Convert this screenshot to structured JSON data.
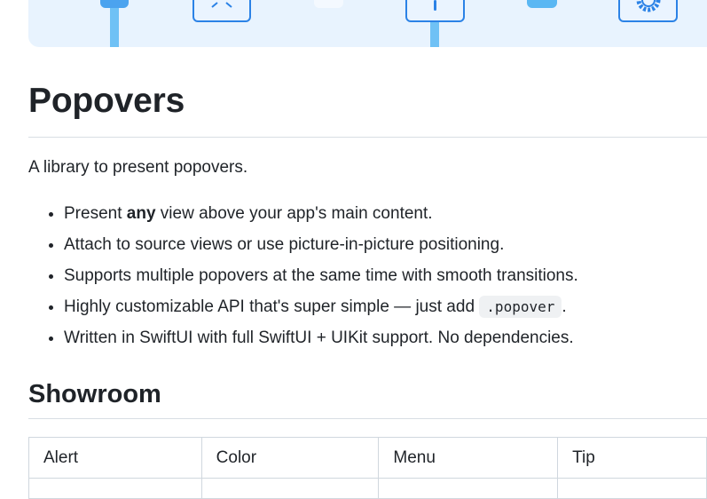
{
  "banner": {
    "icons": [
      "popover-tile-icon",
      "popover-pill-icon",
      "popover-tile-icon",
      "popover-pill-icon",
      "gear-icon"
    ],
    "colors": {
      "background": "#e8f3fe",
      "accent": "#2b82e6",
      "line": "#6fc1f5"
    }
  },
  "title": "Popovers",
  "intro": "A library to present popovers.",
  "features": {
    "item1": {
      "before": "Present ",
      "bold": "any",
      "after": " view above your app's main content."
    },
    "item2": "Attach to source views or use picture-in-picture positioning.",
    "item3": "Supports multiple popovers at the same time with smooth transitions.",
    "item4": {
      "before": "Highly customizable API that's super simple — just add ",
      "code": ".popover",
      "after": "."
    },
    "item5": "Written in SwiftUI with full SwiftUI + UIKit support. No dependencies."
  },
  "showroom": {
    "heading": "Showroom",
    "columns": [
      "Alert",
      "Color",
      "Menu",
      "Tip"
    ]
  }
}
